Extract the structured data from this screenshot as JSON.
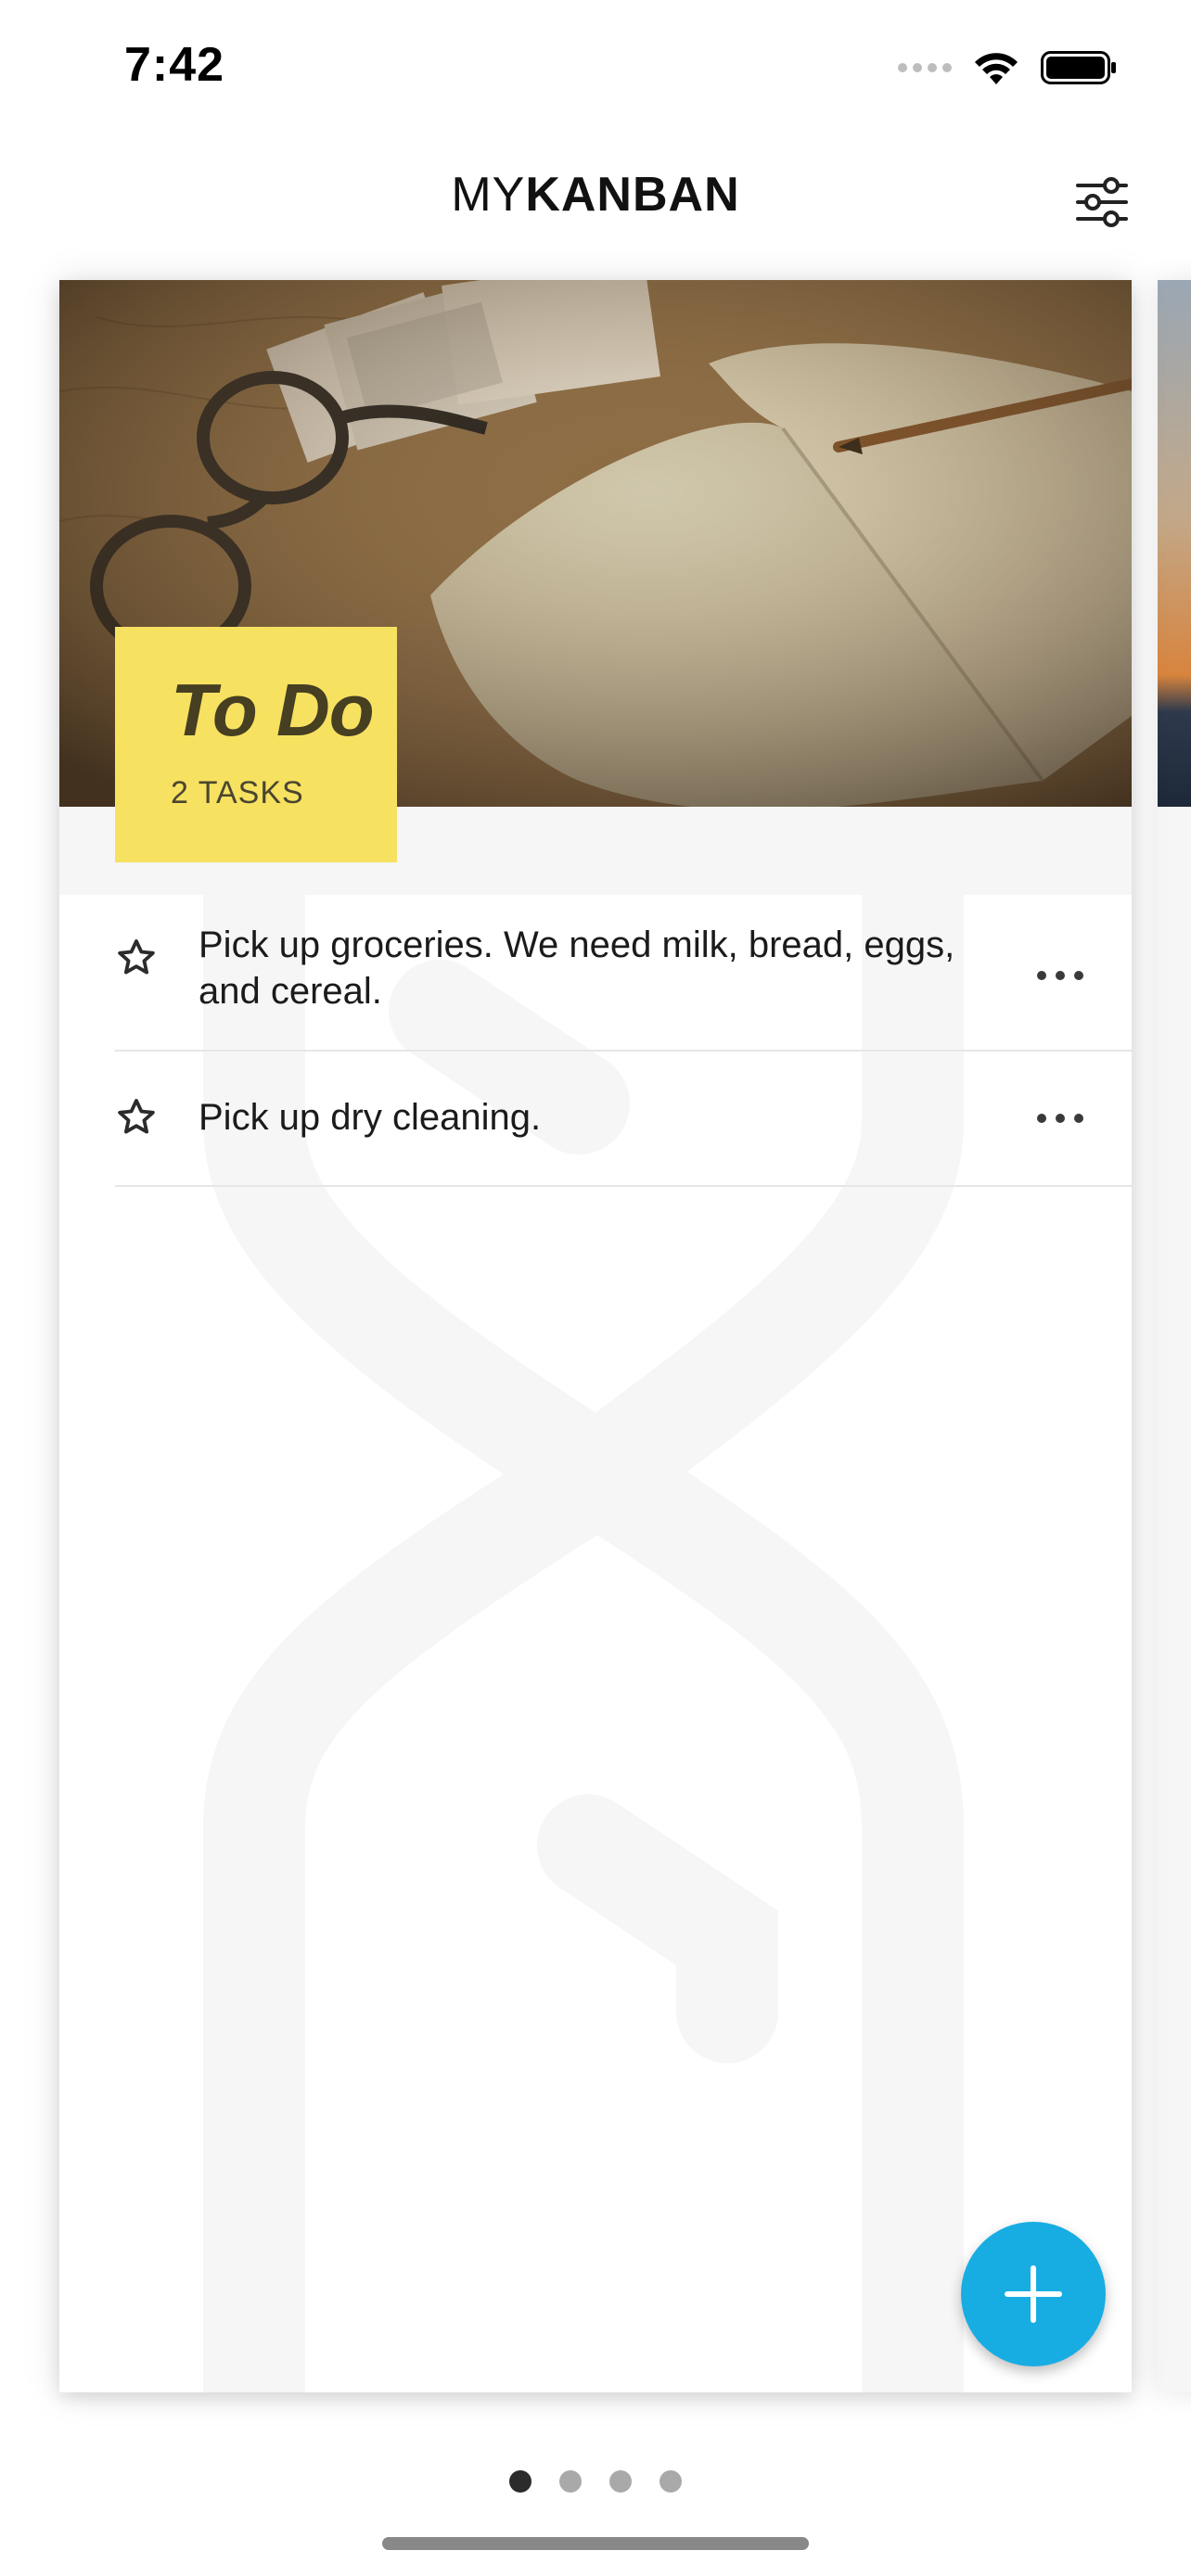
{
  "status_bar": {
    "time": "7:42",
    "icons": [
      "cellular-dots-icon",
      "wifi-icon",
      "battery-icon"
    ]
  },
  "header": {
    "title_light": "MY",
    "title_bold": "KANBAN",
    "filter_icon": "sliders-icon"
  },
  "column": {
    "title": "To Do",
    "count": "2 TASKS",
    "badge_color": "#f7e160",
    "header_image": "notebook-glasses-photo",
    "tasks": [
      {
        "text": "Pick up groceries. We need milk, bread, eggs, and cereal.",
        "starred": false
      },
      {
        "text": "Pick up dry cleaning.",
        "starred": false
      }
    ]
  },
  "fab": {
    "icon": "plus-icon",
    "color": "#17ade2"
  },
  "pager": {
    "pages": 4,
    "active_index": 0
  }
}
